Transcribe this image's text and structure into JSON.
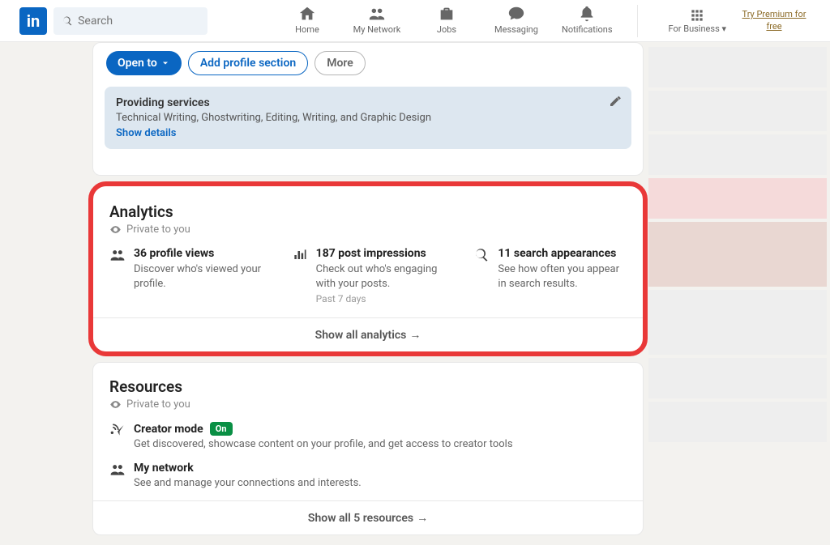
{
  "nav": {
    "logo_text": "in",
    "search_placeholder": "Search",
    "items": [
      {
        "label": "Home"
      },
      {
        "label": "My Network"
      },
      {
        "label": "Jobs"
      },
      {
        "label": "Messaging"
      },
      {
        "label": "Notifications"
      }
    ],
    "business_label": "For Business",
    "premium_link": "Try Premium for free"
  },
  "profile_actions": {
    "open_to": "Open to",
    "add_section": "Add profile section",
    "more": "More"
  },
  "services_card": {
    "title": "Providing services",
    "text": "Technical Writing, Ghostwriting, Editing, Writing, and Graphic Design",
    "link": "Show details"
  },
  "analytics": {
    "heading": "Analytics",
    "private_label": "Private to you",
    "stats": [
      {
        "title": "36 profile views",
        "sub": "Discover who's viewed your profile.",
        "meta": ""
      },
      {
        "title": "187 post impressions",
        "sub": "Check out who's engaging with your posts.",
        "meta": "Past 7 days"
      },
      {
        "title": "11 search appearances",
        "sub": "See how often you appear in search results.",
        "meta": ""
      }
    ],
    "show_all": "Show all analytics"
  },
  "resources": {
    "heading": "Resources",
    "private_label": "Private to you",
    "items": [
      {
        "title": "Creator mode",
        "badge": "On",
        "sub": "Get discovered, showcase content on your profile, and get access to creator tools"
      },
      {
        "title": "My network",
        "badge": "",
        "sub": "See and manage your connections and interests."
      }
    ],
    "show_all": "Show all 5 resources"
  }
}
